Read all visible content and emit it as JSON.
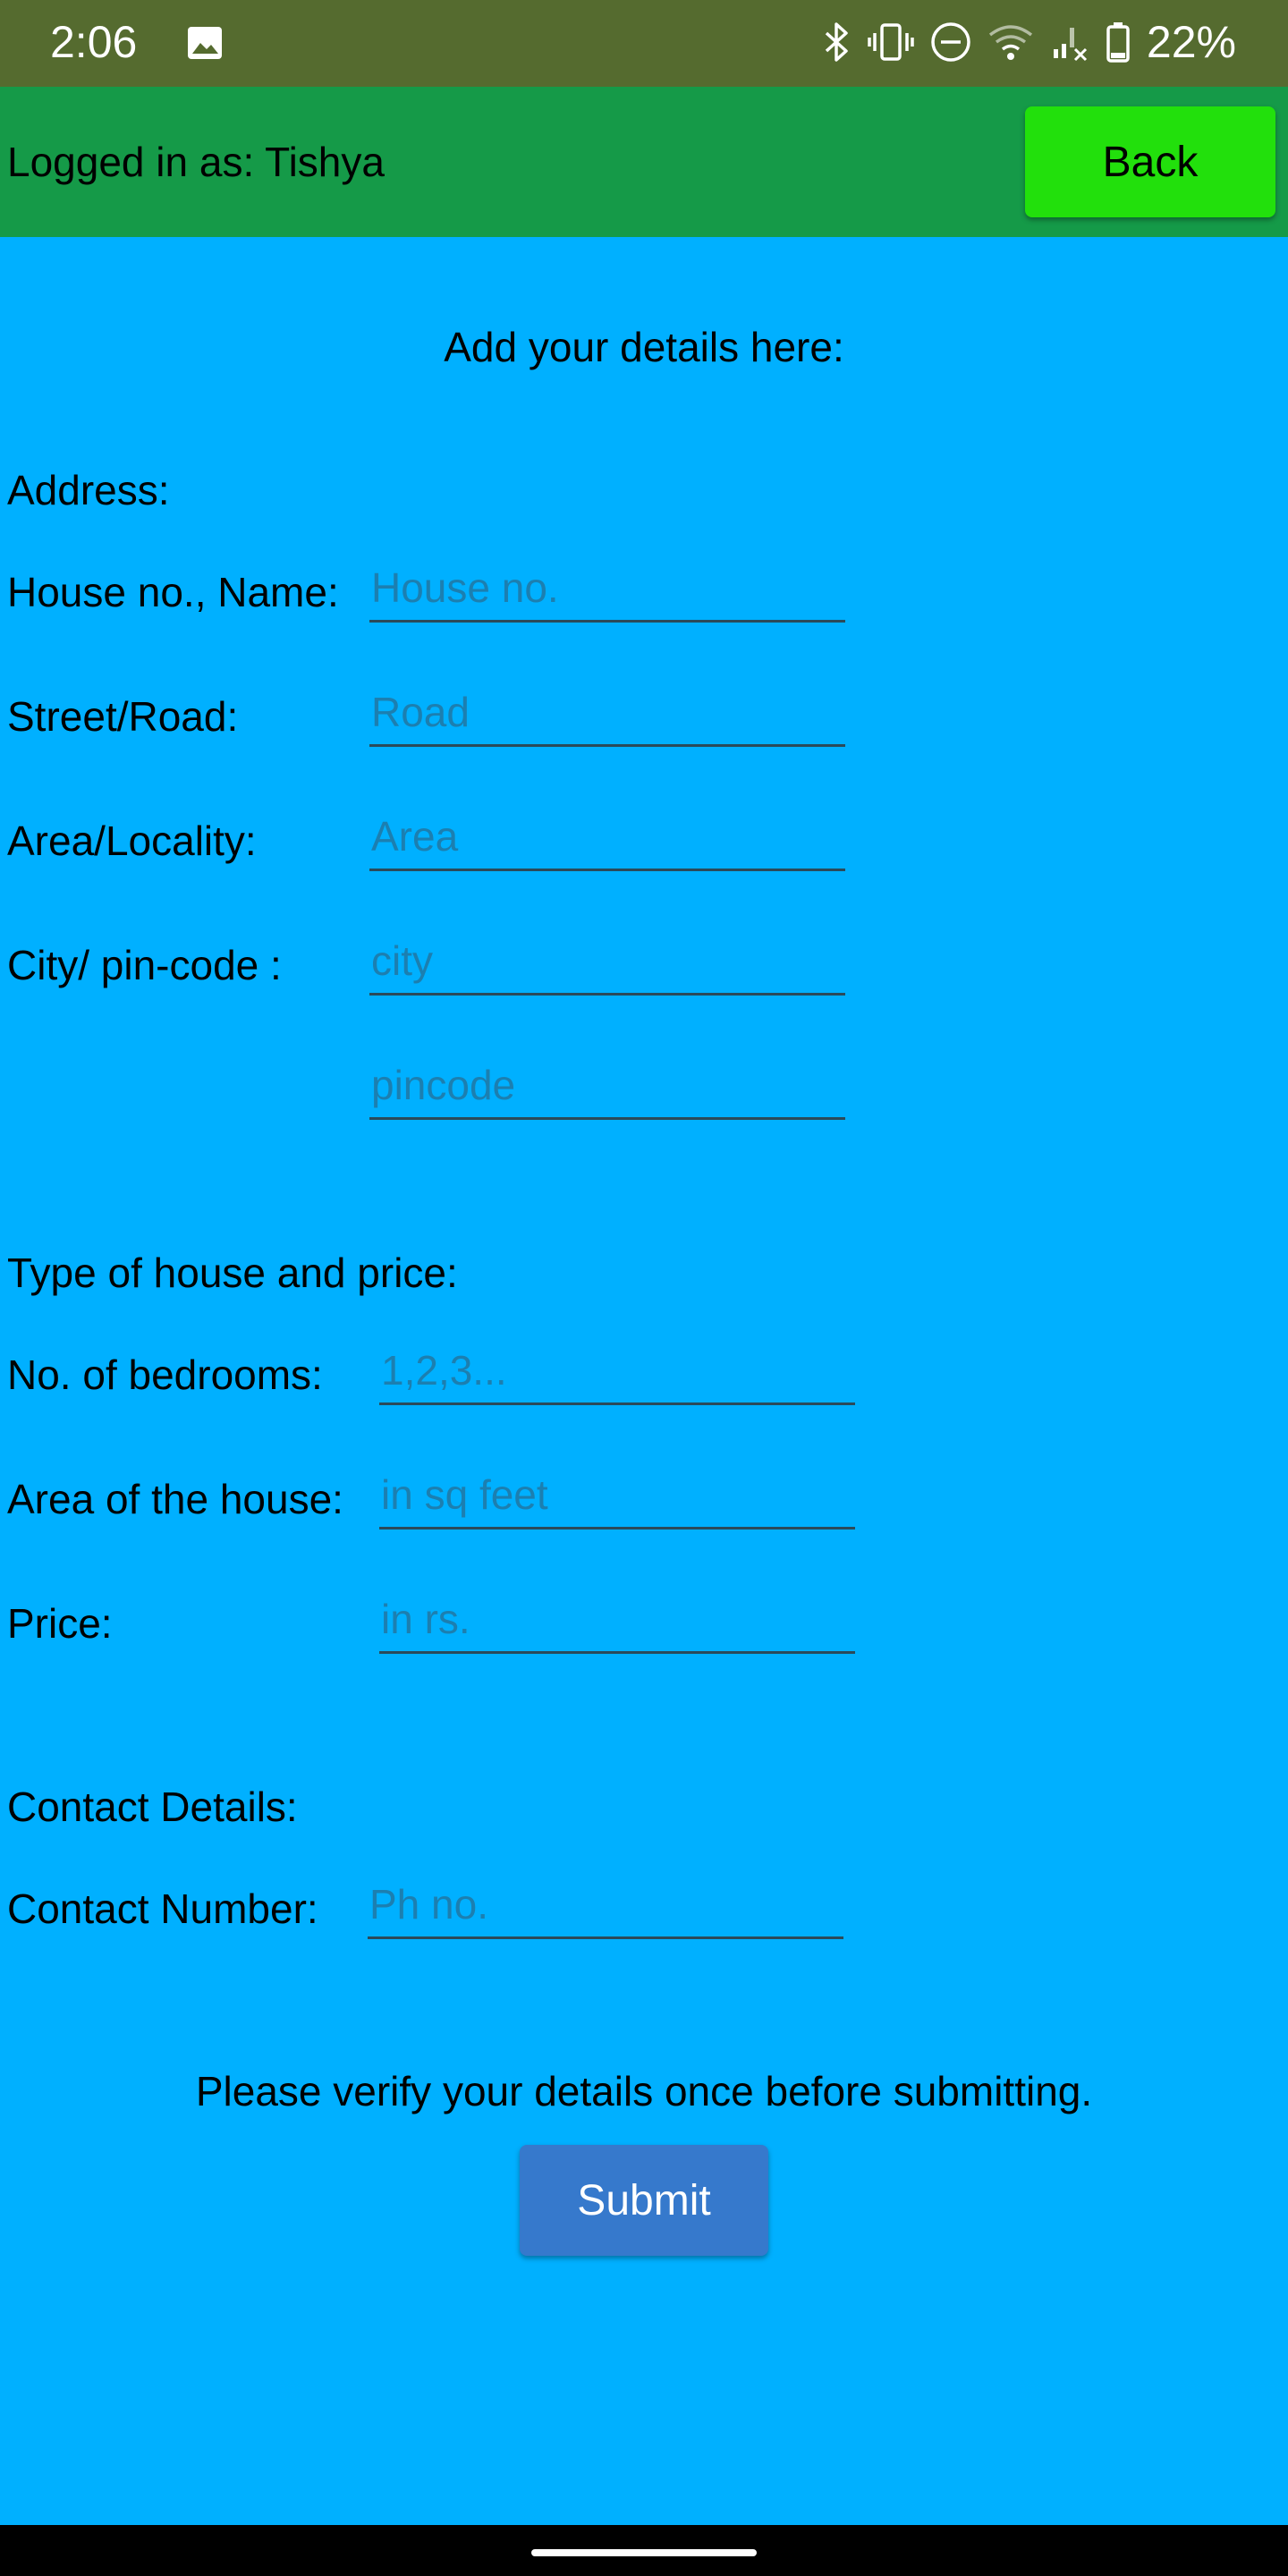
{
  "status_bar": {
    "time": "2:06",
    "battery": "22%",
    "icons": [
      "image-icon",
      "bluetooth-icon",
      "vibrate-icon",
      "do-not-disturb-icon",
      "wifi-icon",
      "signal-icon",
      "battery-icon"
    ]
  },
  "header": {
    "logged_in": "Logged in as: Tishya",
    "back_label": "Back",
    "color": "#159A48",
    "back_color": "#22E00C"
  },
  "form": {
    "heading": "Add your details here:",
    "address": {
      "section": "Address:",
      "house_label": "House no., Name:",
      "house_placeholder": "House no.",
      "street_label": "Street/Road:",
      "street_placeholder": "Road",
      "area_label": "Area/Locality:",
      "area_placeholder": "Area",
      "city_label": "City/ pin-code :",
      "city_placeholder": "city",
      "pincode_placeholder": "pincode"
    },
    "house": {
      "section": "Type of house and price:",
      "bedrooms_label": "No. of bedrooms:",
      "bedrooms_placeholder": "1,2,3...",
      "area_label": "Area of the house:",
      "area_placeholder": "in sq feet",
      "price_label": "Price:",
      "price_placeholder": "in rs."
    },
    "contact": {
      "section": "Contact Details:",
      "number_label": "Contact Number:",
      "number_placeholder": "Ph no."
    },
    "verify_note": "Please verify your details once before submitting.",
    "submit_label": "Submit"
  },
  "colors": {
    "background": "#00B0FF",
    "status_bar": "#556B2F",
    "submit": "#3679CC",
    "placeholder": "#1C7FB0"
  }
}
